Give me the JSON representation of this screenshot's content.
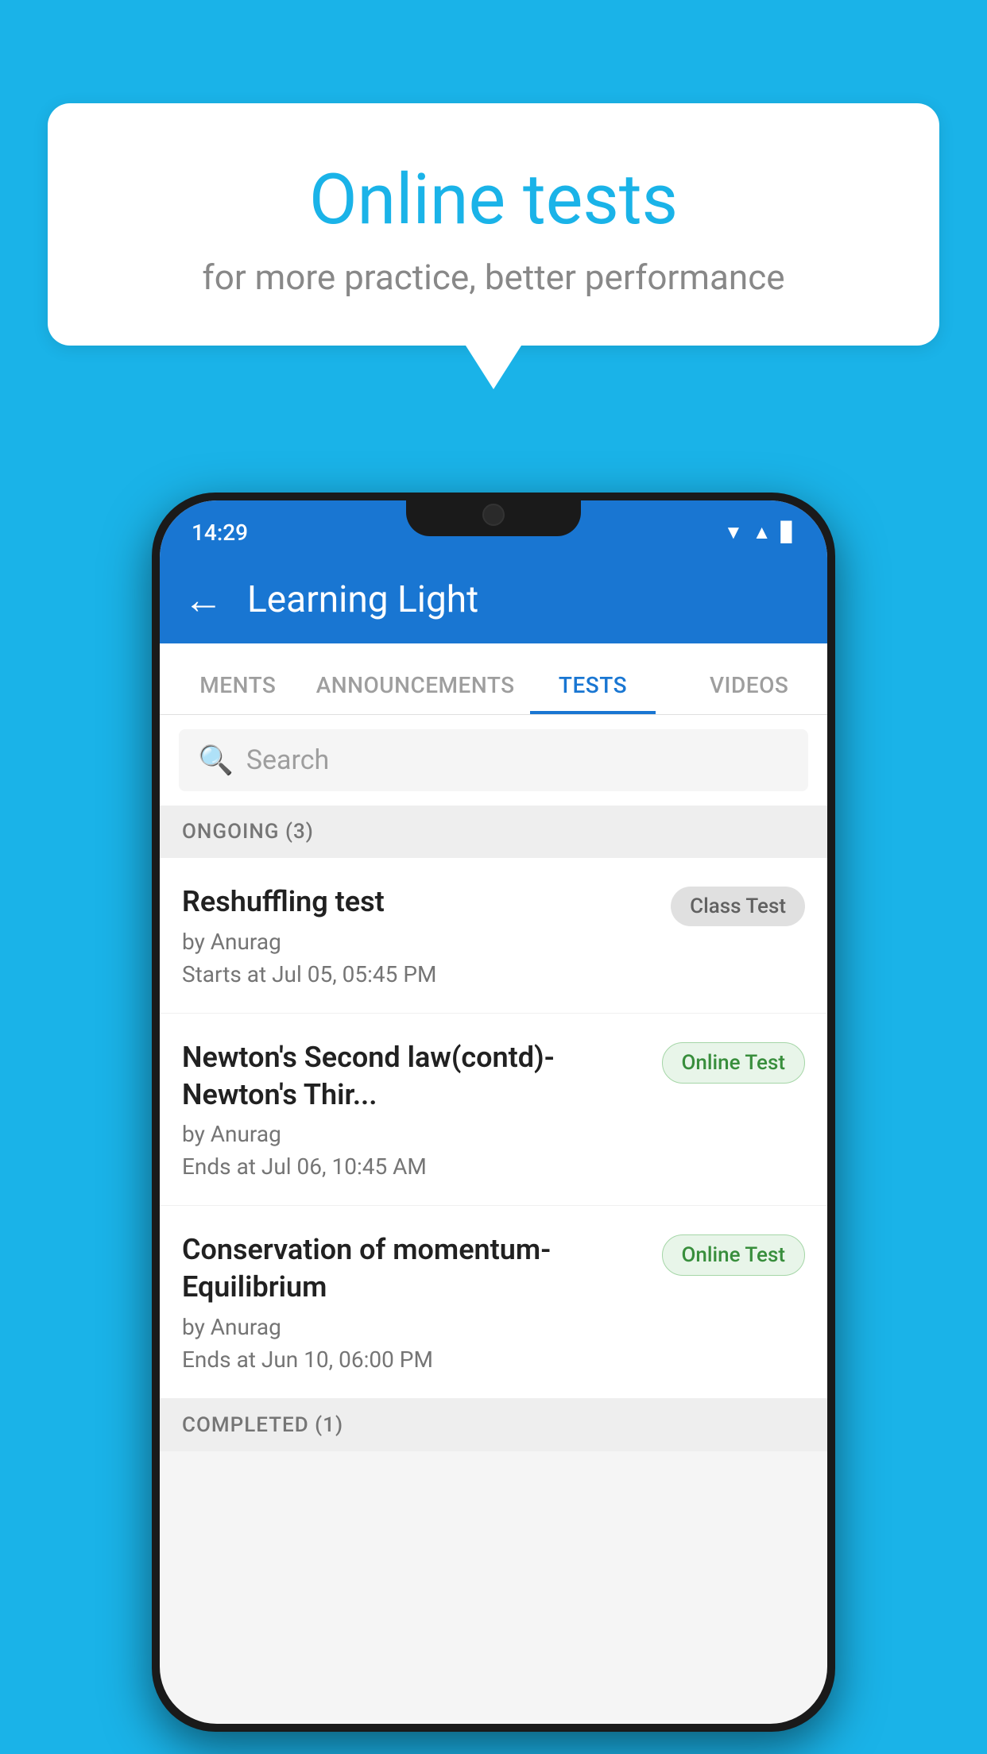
{
  "background_color": "#1ab3e8",
  "bubble": {
    "title": "Online tests",
    "subtitle": "for more practice, better performance"
  },
  "phone": {
    "status_bar": {
      "time": "14:29",
      "icons": [
        "wifi",
        "signal",
        "battery"
      ]
    },
    "app_bar": {
      "back_label": "←",
      "title": "Learning Light"
    },
    "tabs": [
      {
        "label": "MENTS",
        "active": false
      },
      {
        "label": "ANNOUNCEMENTS",
        "active": false
      },
      {
        "label": "TESTS",
        "active": true
      },
      {
        "label": "VIDEOS",
        "active": false
      }
    ],
    "search": {
      "placeholder": "Search"
    },
    "ongoing_section": {
      "label": "ONGOING (3)"
    },
    "tests": [
      {
        "title": "Reshuffling test",
        "author": "by Anurag",
        "date": "Starts at  Jul 05, 05:45 PM",
        "badge": "Class Test",
        "badge_type": "class"
      },
      {
        "title": "Newton's Second law(contd)-Newton's Thir...",
        "author": "by Anurag",
        "date": "Ends at  Jul 06, 10:45 AM",
        "badge": "Online Test",
        "badge_type": "online"
      },
      {
        "title": "Conservation of momentum-Equilibrium",
        "author": "by Anurag",
        "date": "Ends at  Jun 10, 06:00 PM",
        "badge": "Online Test",
        "badge_type": "online"
      }
    ],
    "completed_section": {
      "label": "COMPLETED (1)"
    }
  }
}
